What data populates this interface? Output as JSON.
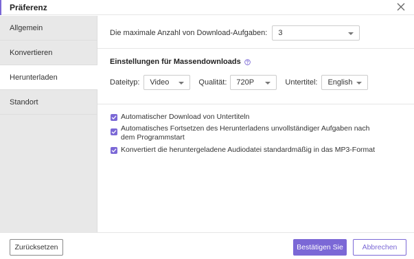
{
  "window": {
    "title": "Präferenz"
  },
  "sidebar": {
    "items": [
      {
        "label": "Allgemein"
      },
      {
        "label": "Konvertieren"
      },
      {
        "label": "Herunterladen",
        "active": true
      },
      {
        "label": "Standort"
      }
    ]
  },
  "download_tasks": {
    "label": "Die maximale Anzahl von Download-Aufgaben:",
    "value": "3"
  },
  "bulk": {
    "title": "Einstellungen für Massendownloads",
    "help_icon": "question-circle-icon",
    "file_type": {
      "label": "Dateityp:",
      "value": "Video"
    },
    "quality": {
      "label": "Qualität:",
      "value": "720P"
    },
    "subtitle": {
      "label": "Untertitel:",
      "value": "English"
    }
  },
  "options": [
    {
      "label": "Automatischer Download von Untertiteln",
      "checked": true
    },
    {
      "label": "Automatisches Fortsetzen des Herunterladens unvollständiger Aufgaben nach dem Programmstart",
      "checked": true
    },
    {
      "label": "Konvertiert die heruntergeladene Audiodatei standardmäßig in das MP3-Format",
      "checked": true
    }
  ],
  "footer": {
    "reset_label": "Zurücksetzen",
    "confirm_label": "Bestätigen Sie",
    "cancel_label": "Abbrechen"
  },
  "colors": {
    "accent": "#7b68d6",
    "sidebar_bg": "#e8e8e8"
  }
}
